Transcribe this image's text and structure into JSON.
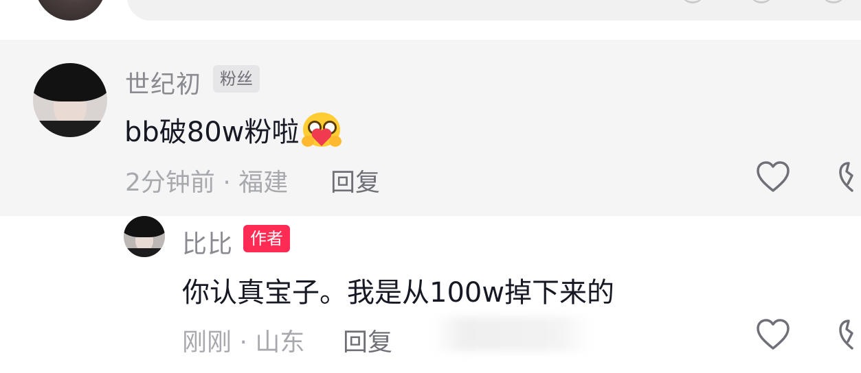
{
  "parent_comment": {
    "username": "世纪初",
    "badge": "粉丝",
    "text": "bb破80w粉啦",
    "time_location": "2分钟前 · 福建",
    "reply_label": "回复"
  },
  "reply_comment": {
    "username": "比比",
    "badge": "作者",
    "text": "你认真宝子。我是从100w掉下来的",
    "time_location": "刚刚 · 山东",
    "reply_label": "回复"
  },
  "colors": {
    "highlight_bg": "#f5f5f5",
    "author_badge": "#fe2c55",
    "fan_badge_bg": "#e6e6e8"
  },
  "icons": {
    "like": "heart-outline-icon",
    "dislike": "broken-heart-icon",
    "emoji": "heart-hug-emoji"
  }
}
